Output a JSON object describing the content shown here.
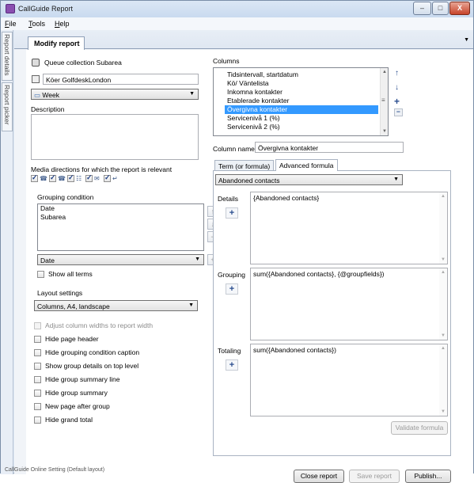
{
  "window": {
    "title": "CallGuide Report",
    "minimize": "–",
    "maximize": "□",
    "close": "X"
  },
  "menu": [
    {
      "label": "File",
      "key": "F",
      "rest": "ile"
    },
    {
      "label": "Tools",
      "key": "T",
      "rest": "ools"
    },
    {
      "label": "Help",
      "key": "H",
      "rest": "elp"
    }
  ],
  "side_tabs": {
    "report_details": "Report details",
    "report_picker": "Report picker"
  },
  "doc_tab": {
    "label": "Modify report"
  },
  "left": {
    "queue_collection": "Queue collection Subarea",
    "queue_name": "Köer GolfdeskLondon",
    "period": "Week",
    "description_label": "Description",
    "description_value": "",
    "media_label": "Media directions for which the report is relevant",
    "media_items": [
      {
        "checked": true,
        "icon": "phone-in-icon",
        "glyph": "☎"
      },
      {
        "checked": true,
        "icon": "phone-out-icon",
        "glyph": "☎"
      },
      {
        "checked": true,
        "icon": "callback-icon",
        "glyph": "☷"
      },
      {
        "checked": true,
        "icon": "email-icon",
        "glyph": "✉"
      },
      {
        "checked": true,
        "icon": "chat-icon",
        "glyph": "↵"
      }
    ],
    "grouping_label": "Grouping condition",
    "grouping_items": [
      "Date",
      "Subarea"
    ],
    "grouping_select": "Date",
    "show_all_terms": "Show all terms",
    "layout_label": "Layout settings",
    "layout_select": "Columns, A4, landscape",
    "options": [
      {
        "label": "Adjust column widths to report width",
        "checked": false,
        "disabled": true
      },
      {
        "label": "Hide page header",
        "checked": false,
        "disabled": false
      },
      {
        "label": "Hide grouping condition caption",
        "checked": false,
        "disabled": false
      },
      {
        "label": "Show group details on top level",
        "checked": false,
        "disabled": false
      },
      {
        "label": "Hide group summary line",
        "checked": false,
        "disabled": false
      },
      {
        "label": "Hide group summary",
        "checked": false,
        "disabled": false
      },
      {
        "label": "New page after group",
        "checked": false,
        "disabled": false
      },
      {
        "label": "Hide grand total",
        "checked": false,
        "disabled": false
      }
    ]
  },
  "right": {
    "columns_label": "Columns",
    "columns": [
      "Tidsintervall, startdatum",
      "Kö/ Väntelista",
      "Inkomna kontakter",
      "Etablerade kontakter",
      "Övergivna kontakter",
      "Servicenivå 1 (%)",
      "Servicenivå 2 (%)"
    ],
    "selected_column_index": 4,
    "column_name_label": "Column name",
    "column_name_value": "Övergivna kontakter",
    "tabs": [
      "Term (or formula)",
      "Advanced formula"
    ],
    "active_tab": 1,
    "formula_select": "Abandoned contacts",
    "details_label": "Details",
    "details_value": "{Abandoned contacts}",
    "grouping_label": "Grouping",
    "grouping_value": "sum({Abandoned contacts}, {@groupfields})",
    "totaling_label": "Totaling",
    "totaling_value": "sum({Abandoned contacts})",
    "validate_label": "Validate formula"
  },
  "buttons": {
    "close": "Close report",
    "save": "Save report",
    "publish": "Publish..."
  },
  "status": "CallGuide Online Setting (Default layout)"
}
